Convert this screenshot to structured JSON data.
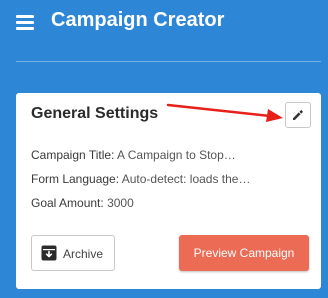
{
  "header": {
    "title": "Campaign Creator",
    "menu_icon": "hamburger-menu-icon"
  },
  "card": {
    "title": "General Settings",
    "edit_icon": "pencil-icon",
    "fields": [
      {
        "label": "Campaign Title:",
        "value": "A Campaign to Stop…"
      },
      {
        "label": "Form Language:",
        "value": "Auto-detect: loads the…"
      },
      {
        "label": "Goal Amount:",
        "value": "3000"
      }
    ],
    "archive_label": "Archive",
    "archive_icon": "archive-box-icon",
    "preview_label": "Preview Campaign"
  },
  "colors": {
    "background": "#2e86d7",
    "card": "#ffffff",
    "preview_button": "#ec6b55",
    "annotation_arrow": "#e8201a"
  }
}
